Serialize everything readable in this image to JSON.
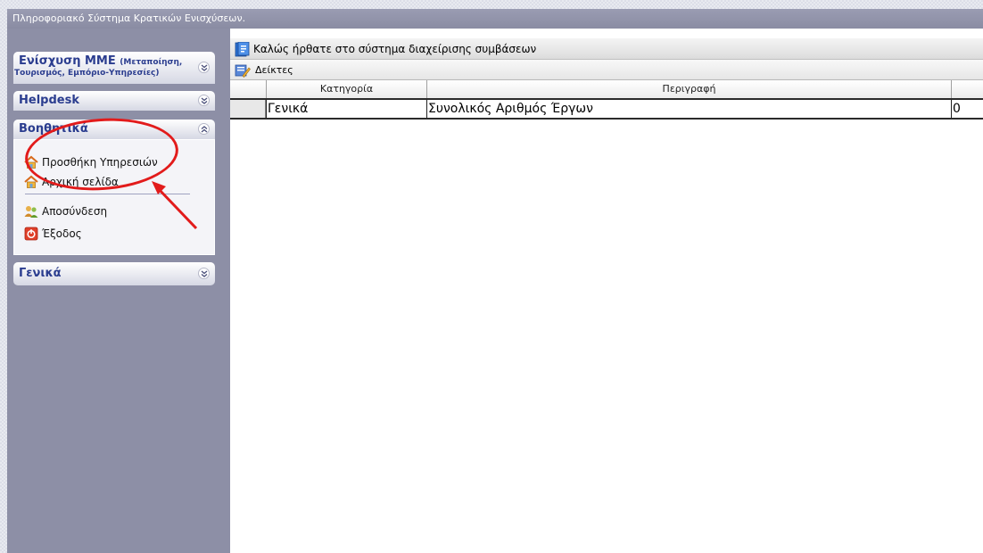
{
  "titlebar": {
    "text": "Πληροφοριακό Σύστημα Κρατικών Ενισχύσεων."
  },
  "sidebar": {
    "panels": [
      {
        "title": "Ενίσχυση ΜΜΕ",
        "title_small": "(Μεταποίηση,",
        "subtitle": "Τουρισμός, Εμπόριο-Υπηρεσίες)",
        "expanded": false,
        "chevron_icon": "chevron-double-down-icon"
      },
      {
        "title": "Helpdesk",
        "expanded": false,
        "chevron_icon": "chevron-double-down-icon"
      },
      {
        "title": "Βοηθητικά",
        "expanded": true,
        "chevron_icon": "chevron-double-up-icon",
        "items": [
          {
            "label": "Προσθήκη Υπηρεσιών",
            "icon": "home-icon"
          },
          {
            "label": "Αρχική σελίδα",
            "icon": "home-icon"
          },
          {
            "label": "Αποσύνδεση",
            "icon": "users-logout-icon"
          },
          {
            "label": "Έξοδος",
            "icon": "power-exit-icon"
          }
        ]
      },
      {
        "title": "Γενικά",
        "expanded": false,
        "chevron_icon": "chevron-double-down-icon"
      }
    ]
  },
  "main": {
    "header": {
      "text": "Καλώς ήρθατε στο σύστημα διαχείρισης συμβάσεων",
      "icon": "document-icon"
    },
    "toolbar": {
      "label": "Δείκτες",
      "icon": "edit-document-icon"
    },
    "table": {
      "columns": [
        "",
        "Κατηγορία",
        "Περιγραφή",
        ""
      ],
      "rows": [
        [
          "",
          "Γενικά",
          "Συνολικός Αριθμός Έργων",
          "0"
        ]
      ]
    }
  },
  "colors": {
    "sidebar_bg": "#8d8fa6",
    "panel_title": "#2b3d8f",
    "annotation": "#e21b1b"
  }
}
